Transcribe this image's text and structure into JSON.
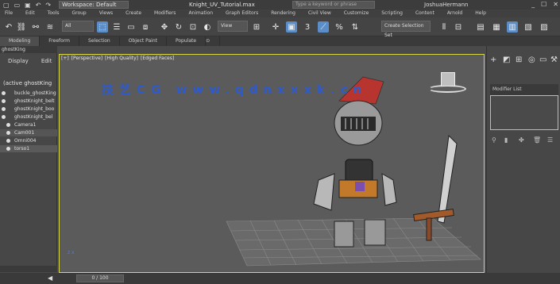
{
  "titlebar": {
    "workspace": "Workspace: Default",
    "title": "Knight_UV_Tutorial.max",
    "search_placeholder": "Type a keyword or phrase",
    "user": "JoshuaHermann",
    "window_controls": [
      "_",
      "☐",
      "✕"
    ]
  },
  "menu": [
    "File",
    "Edit",
    "Tools",
    "Group",
    "Views",
    "Create",
    "Modifiers",
    "Animation",
    "Graph Editors",
    "Rendering",
    "Civil View",
    "Customize",
    "Scripting",
    "Content",
    "Arnold",
    "Help"
  ],
  "toolbar": {
    "undo_icon": "undo-icon",
    "selection_filter": "All",
    "view_dropdown": "View",
    "named_selection": "Create Selection Set",
    "accent": "#5b8ec9"
  },
  "ribbon": {
    "tabs": [
      "Modeling",
      "Freeform",
      "Selection",
      "Object Paint",
      "Populate"
    ]
  },
  "scene_explorer": {
    "breadcrumb": "ghostKing",
    "tabs": [
      "Display",
      "Edit"
    ],
    "root": "(active ghostKing",
    "items": [
      {
        "label": "buckle_ghostKing"
      },
      {
        "label": "ghostKnight_belt"
      },
      {
        "label": "ghostKnight_boo"
      },
      {
        "label": "ghostKnight_bel"
      },
      {
        "label": "Camera1"
      },
      {
        "label": "Cam001"
      },
      {
        "label": "Omni004"
      },
      {
        "label": "torso1"
      }
    ]
  },
  "viewport": {
    "labels": [
      "[+]",
      "[Perspective]",
      "[High Quality]",
      "[Edged Faces]"
    ],
    "border_color": "#d8d84a",
    "axis_label": "z x"
  },
  "watermark": "技艺CG  www.qdnxxxk.cn",
  "command_panel": {
    "tabs": [
      "+",
      "modify-icon",
      "hierarchy-icon",
      "motion-icon",
      "display-icon",
      "utilities-icon"
    ],
    "modifier_list": "Modifier List"
  },
  "timeline": {
    "frame": "0 / 100"
  }
}
